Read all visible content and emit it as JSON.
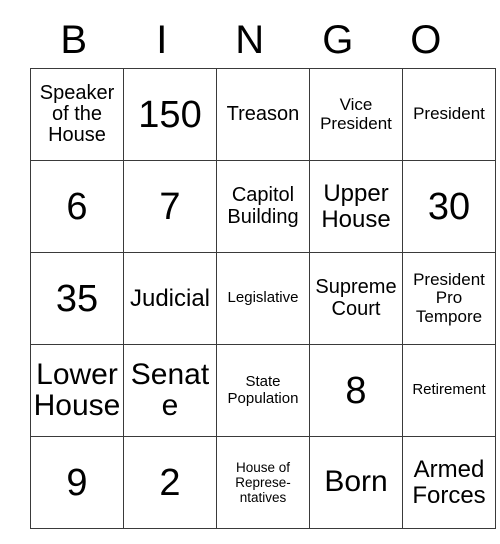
{
  "card": {
    "title": "BINGO",
    "header_letters": [
      "B",
      "I",
      "N",
      "G",
      "O"
    ],
    "rows": [
      [
        {
          "text": "Speaker of the House",
          "size": "md"
        },
        {
          "text": "150",
          "size": "xxl"
        },
        {
          "text": "Treason",
          "size": "md"
        },
        {
          "text": "Vice President",
          "size": "sm"
        },
        {
          "text": "President",
          "size": "sm"
        }
      ],
      [
        {
          "text": "6",
          "size": "xxl"
        },
        {
          "text": "7",
          "size": "xxl"
        },
        {
          "text": "Capitol Building",
          "size": "md"
        },
        {
          "text": "Upper House",
          "size": "lg"
        },
        {
          "text": "30",
          "size": "xxl"
        }
      ],
      [
        {
          "text": "35",
          "size": "xxl"
        },
        {
          "text": "Judicial",
          "size": "lg"
        },
        {
          "text": "Legislative",
          "size": "xs"
        },
        {
          "text": "Supreme Court",
          "size": "md"
        },
        {
          "text": "President Pro Tempore",
          "size": "sm"
        }
      ],
      [
        {
          "text": "Lower House",
          "size": "xl"
        },
        {
          "text": "Senate",
          "size": "xl"
        },
        {
          "text": "State Population",
          "size": "xs"
        },
        {
          "text": "8",
          "size": "xxl"
        },
        {
          "text": "Retirement",
          "size": "xs"
        }
      ],
      [
        {
          "text": "9",
          "size": "xxl"
        },
        {
          "text": "2",
          "size": "xxl"
        },
        {
          "text": "House of Represe-ntatives",
          "size": "xxs"
        },
        {
          "text": "Born",
          "size": "xl"
        },
        {
          "text": "Armed Forces",
          "size": "lg"
        }
      ]
    ]
  },
  "colors": {
    "background": "#ffffff",
    "text": "#000000",
    "grid_line": "#3a3a3a"
  }
}
